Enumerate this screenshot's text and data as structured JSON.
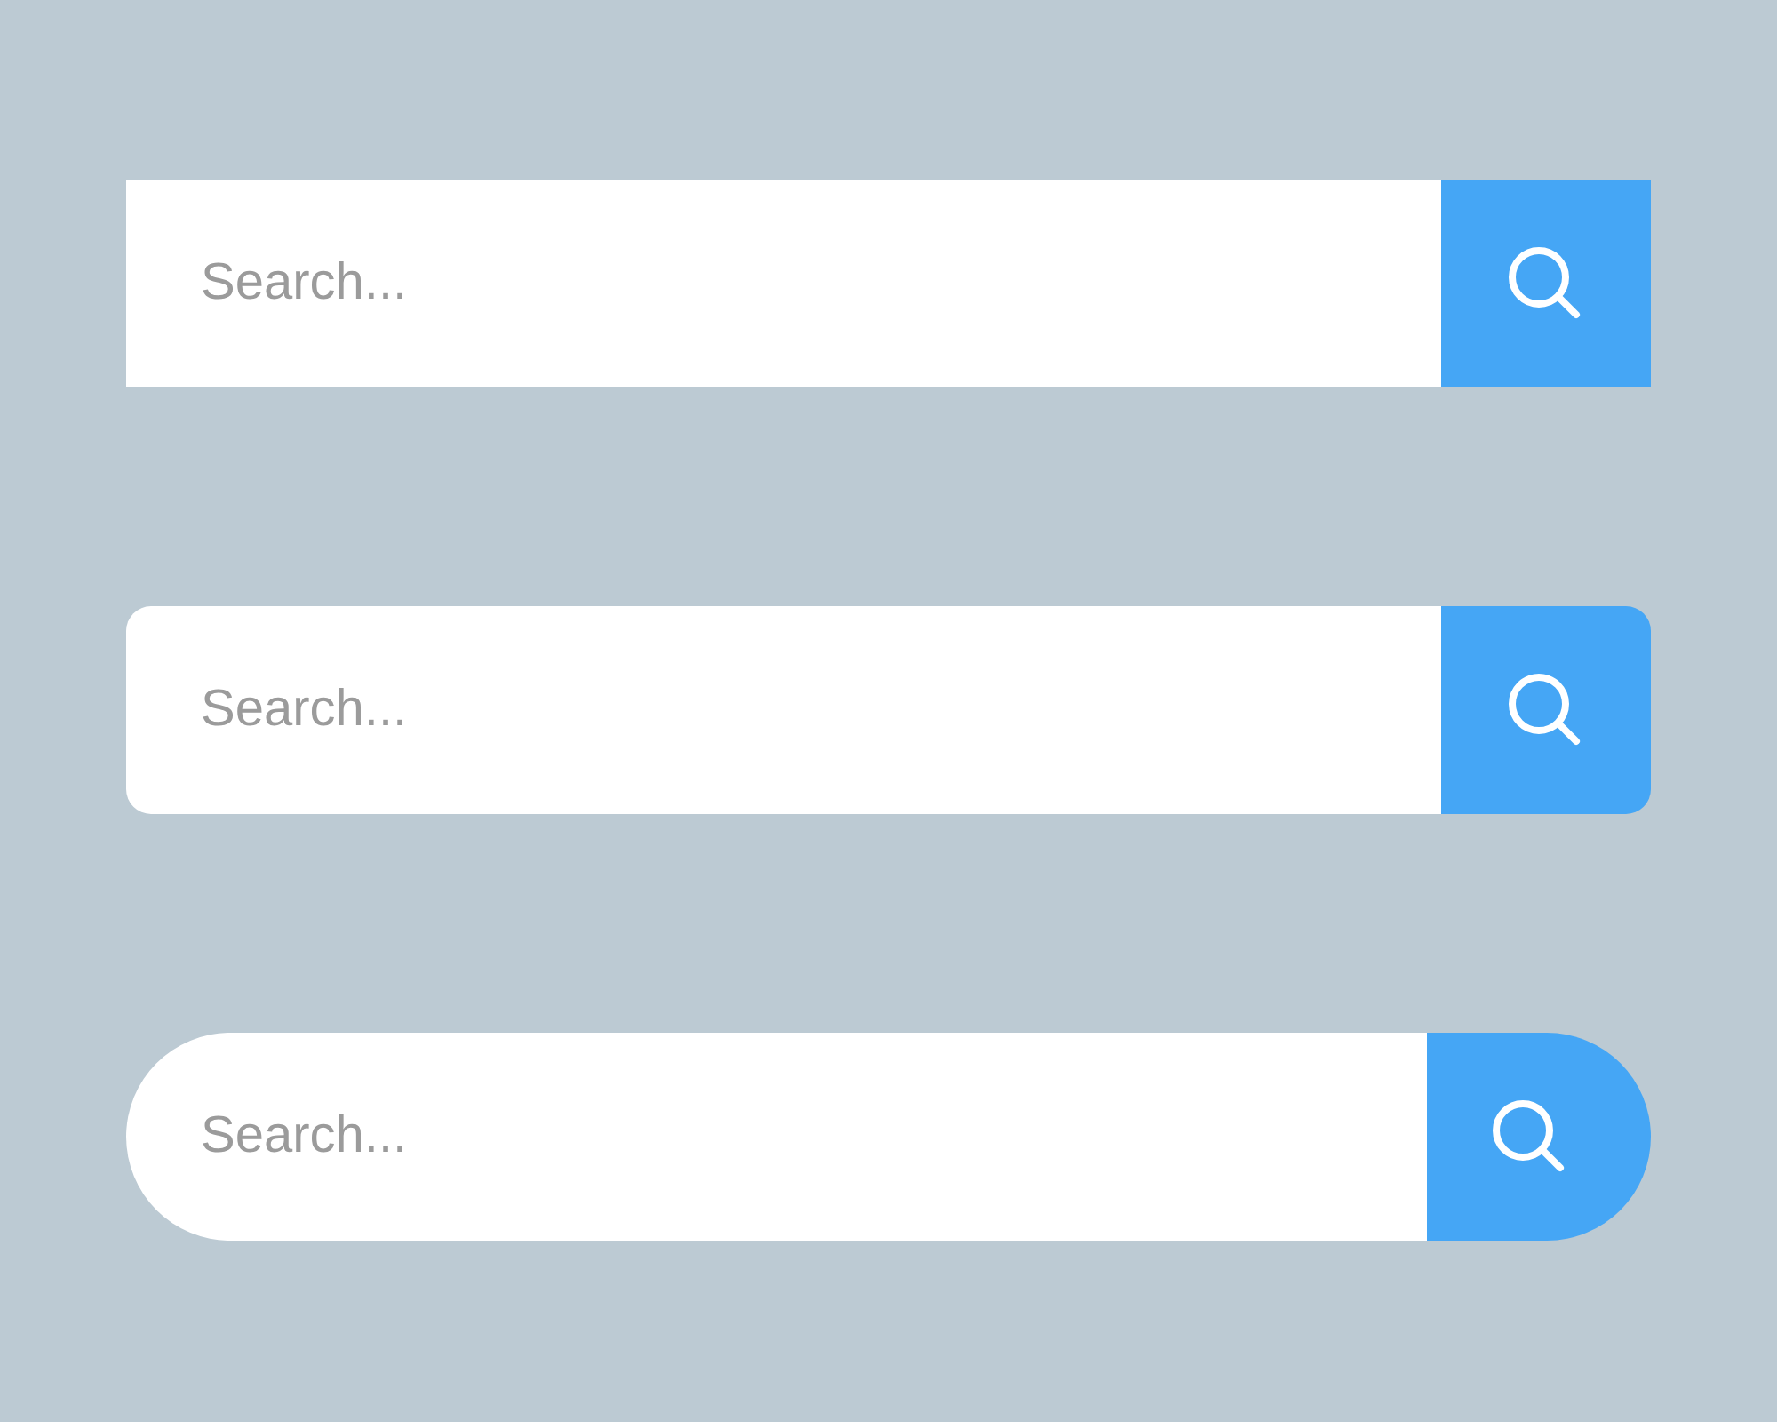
{
  "search_bars": [
    {
      "kind": "square",
      "placeholder": "Search..."
    },
    {
      "kind": "rounded",
      "placeholder": "Search..."
    },
    {
      "kind": "pill",
      "placeholder": "Search..."
    }
  ]
}
